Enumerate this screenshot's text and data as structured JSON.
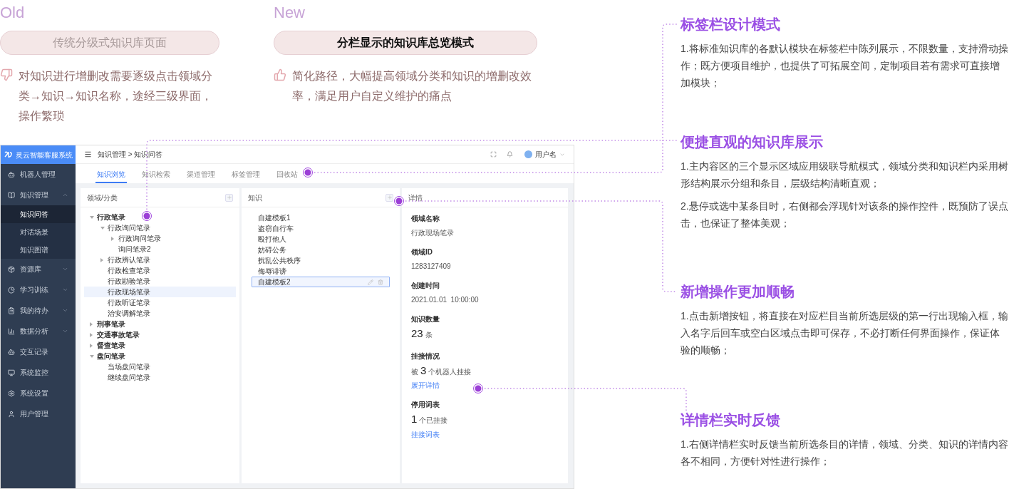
{
  "comparison": [
    {
      "kind": "old",
      "tag": "Old",
      "title": "传统分级式知识库页面",
      "description": "对知识进行增删改需要逐级点击领域分类→知识→知识名称，途经三级界面，操作繁琐"
    },
    {
      "kind": "new",
      "tag": "New",
      "title": "分栏显示的知识库总览模式",
      "description": "简化路径，大幅提高领域分类和知识的增删改效率，满足用户自定义维护的痛点"
    }
  ],
  "app": {
    "logo_text": "灵云智能客服系统",
    "sidebar": {
      "items": [
        {
          "kind": "link",
          "label": "机器人管理"
        },
        {
          "kind": "group",
          "label": "知识管理",
          "expanded": true,
          "children": [
            {
              "label": "知识问答",
              "selected": true
            },
            {
              "label": "对话场景",
              "selected": false
            },
            {
              "label": "知识图谱",
              "selected": false
            }
          ]
        },
        {
          "kind": "group",
          "label": "资源库",
          "expanded": false
        },
        {
          "kind": "group",
          "label": "学习训练",
          "expanded": false
        },
        {
          "kind": "group",
          "label": "我的待办",
          "expanded": false
        },
        {
          "kind": "group",
          "label": "数据分析",
          "expanded": false
        },
        {
          "kind": "link",
          "label": "交互记录"
        },
        {
          "kind": "link",
          "label": "系统监控"
        },
        {
          "kind": "link",
          "label": "系统设置"
        },
        {
          "kind": "link",
          "label": "用户管理"
        }
      ]
    },
    "breadcrumb": "知识管理 > 知识问答",
    "user_name": "用户名",
    "tabs": [
      {
        "label": "知识浏览",
        "selected": true
      },
      {
        "label": "知识检索",
        "selected": false
      },
      {
        "label": "渠道管理",
        "selected": false
      },
      {
        "label": "标签管理",
        "selected": false
      },
      {
        "label": "回收站",
        "selected": false
      }
    ],
    "category_panel": {
      "title": "领域/分类",
      "tree": [
        {
          "label": "行政笔录",
          "expanded": true,
          "selected": false,
          "children": [
            {
              "label": "行政询问笔录",
              "expanded": true,
              "selected": false,
              "children": [
                {
                  "label": "行政询问笔录",
                  "expanded": false,
                  "selected": false
                },
                {
                  "label": "询问笔录2",
                  "selected": false
                }
              ]
            },
            {
              "label": "行政辨认笔录",
              "expanded": false,
              "selected": false
            },
            {
              "label": "行政检查笔录",
              "selected": false
            },
            {
              "label": "行政勘验笔录",
              "selected": false
            },
            {
              "label": "行政现场笔录",
              "selected": true
            },
            {
              "label": "行政听证笔录",
              "selected": false
            },
            {
              "label": "治安调解笔录",
              "selected": false
            }
          ]
        },
        {
          "label": "刑事笔录",
          "expanded": false,
          "selected": false
        },
        {
          "label": "交通事故笔录",
          "expanded": false,
          "selected": false
        },
        {
          "label": "督查笔录",
          "expanded": false,
          "selected": false
        },
        {
          "label": "盘问笔录",
          "expanded": true,
          "selected": false,
          "children": [
            {
              "label": "当场盘问笔录",
              "selected": false
            },
            {
              "label": "继续盘问笔录",
              "selected": false
            }
          ]
        }
      ]
    },
    "knowledge_panel": {
      "title": "知识",
      "items": [
        {
          "label": "自建模板1",
          "selected": false
        },
        {
          "label": "盗窃自行车",
          "selected": false
        },
        {
          "label": "殴打他人",
          "selected": false
        },
        {
          "label": "妨碍公务",
          "selected": false
        },
        {
          "label": "扰乱公共秩序",
          "selected": false
        },
        {
          "label": "侮辱诽谤",
          "selected": false
        },
        {
          "label": "自建模板2",
          "selected": true
        }
      ]
    },
    "detail_panel": {
      "title": "详情",
      "fields": [
        {
          "kind": "text",
          "label": "领域名称",
          "value": "行政现场笔录"
        },
        {
          "kind": "text",
          "label": "领域ID",
          "value": "1283127409"
        },
        {
          "kind": "text",
          "label": "创建时间",
          "value": "2021.01.01  10:00:00"
        },
        {
          "kind": "count",
          "label": "知识数量",
          "number": "23",
          "unit": "条"
        },
        {
          "kind": "count",
          "label": "挂接情况",
          "prefix": "被",
          "number": "3",
          "unit": "个机器人挂接",
          "link": "展开详情"
        },
        {
          "kind": "count",
          "label": "停用词表",
          "number": "1",
          "unit": "个已挂接",
          "link": "挂接词表"
        }
      ]
    }
  },
  "notes": [
    {
      "title": "标签栏设计模式",
      "paragraphs": [
        "1.将标准知识库的各默认模块在标签栏中陈列展示，不限数量，支持滑动操作；既方便项目维护，也提供了可拓展空间，定制项目若有需求可直接增加模块；"
      ]
    },
    {
      "title": "便捷直观的知识库展示",
      "paragraphs": [
        "1.主内容区的三个显示区域应用级联导航模式，领域分类和知识栏内采用树形结构展示分组和条目，层级结构清晰直观；",
        "2.悬停或选中某条目时，右侧都会浮现针对该条的操作控件，既预防了误点击，也保证了整体美观；"
      ]
    },
    {
      "title": "新增操作更加顺畅",
      "paragraphs": [
        "1.点击新增按钮，将直接在对应栏目当前所选层级的第一行出现输入框，输入名字后回车或空白区域点击即可保存，不必打断任何界面操作，保证体验的顺畅；"
      ]
    },
    {
      "title": "详情栏实时反馈",
      "paragraphs": [
        "1.右侧详情栏实时反馈当前所选条目的详情，领域、分类、知识的详情内容各不相同，方便针对性进行操作；"
      ]
    }
  ]
}
